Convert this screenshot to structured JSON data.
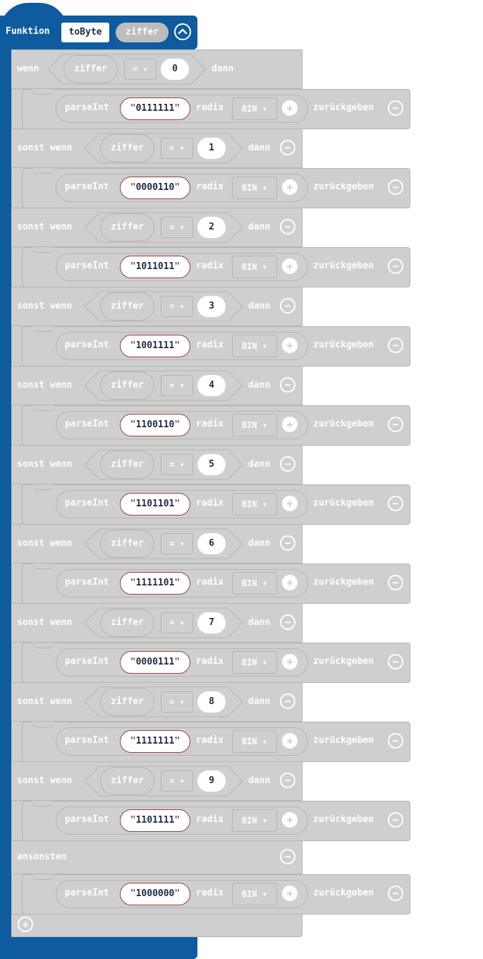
{
  "function": {
    "keyword": "Funktion",
    "name": "toByte",
    "param": "ziffer",
    "collapse_icon": "chevron-up-icon"
  },
  "if_block": {
    "if_label": "wenn",
    "elseif_label": "sonst wenn",
    "then_label": "dann",
    "else_label": "ansonsten",
    "variable": "ziffer",
    "operator": "= ▾",
    "call_label": "parseInt",
    "radix_label": "radix",
    "radix_value": "BIN ▾",
    "return_label": "zurückgeben",
    "plus": "+",
    "minus": "−",
    "branches": [
      {
        "value": "0",
        "binary": "0111111"
      },
      {
        "value": "1",
        "binary": "0000110"
      },
      {
        "value": "2",
        "binary": "1011011"
      },
      {
        "value": "3",
        "binary": "1001111"
      },
      {
        "value": "4",
        "binary": "1100110"
      },
      {
        "value": "5",
        "binary": "1101101"
      },
      {
        "value": "6",
        "binary": "1111101"
      },
      {
        "value": "7",
        "binary": "0000111"
      },
      {
        "value": "8",
        "binary": "1111111"
      },
      {
        "value": "9",
        "binary": "1101111"
      }
    ],
    "else_binary": "1000000"
  }
}
